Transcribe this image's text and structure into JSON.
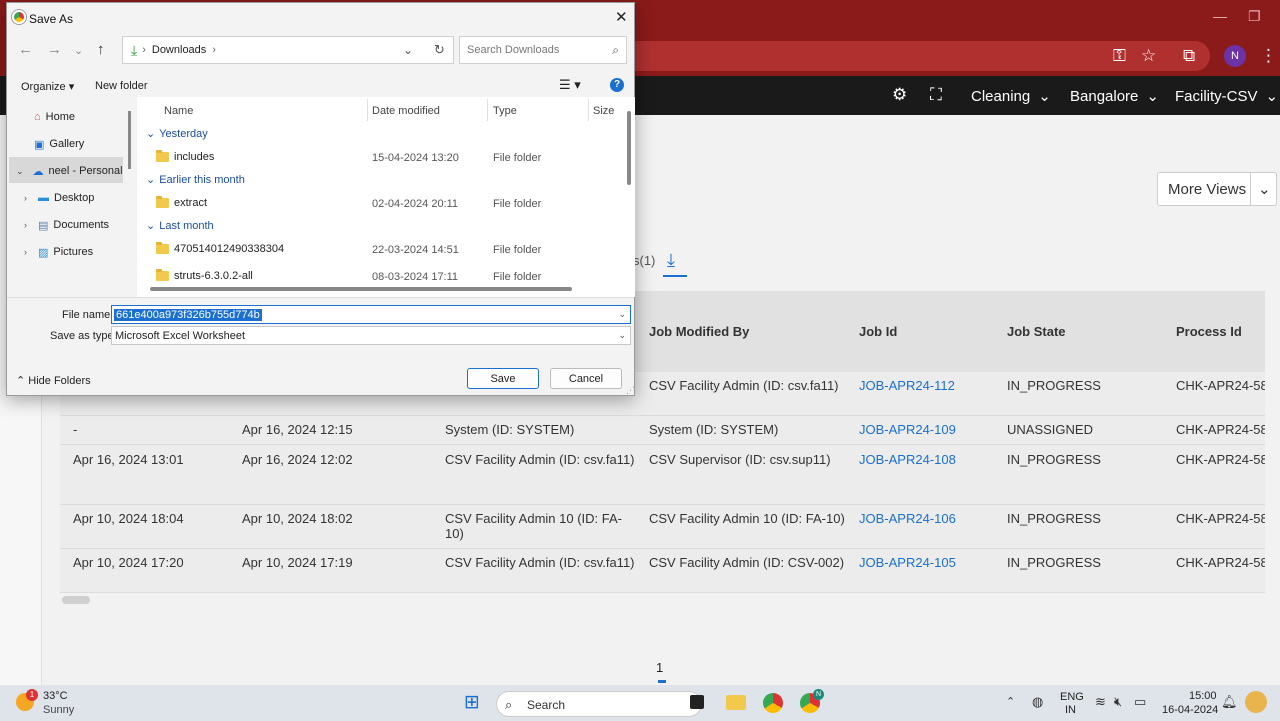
{
  "browser": {
    "avatar_initial": "N"
  },
  "app_header": {
    "items": [
      {
        "label": "Cleaning"
      },
      {
        "label": "Bangalore"
      },
      {
        "label": "Facility-CSV"
      }
    ]
  },
  "page": {
    "more_views": "More Views",
    "count_label": "s(1)",
    "page_number": "1"
  },
  "table": {
    "columns": [
      "Job Modified By",
      "Job Id",
      "Job State",
      "Process Id"
    ],
    "rows": [
      {
        "c1": "",
        "c2": "",
        "c3": "",
        "modified_by": "CSV Facility Admin (ID: csv.fa11)",
        "job_id": "JOB-APR24-112",
        "state": "IN_PROGRESS",
        "process": "CHK-APR24-58"
      },
      {
        "c1": "-",
        "c2": "Apr 16, 2024 12:15",
        "c3": "System (ID: SYSTEM)",
        "modified_by": "System (ID: SYSTEM)",
        "job_id": "JOB-APR24-109",
        "state": "UNASSIGNED",
        "process": "CHK-APR24-58"
      },
      {
        "c1": "Apr 16, 2024 13:01",
        "c2": "Apr 16, 2024 12:02",
        "c3": "CSV Facility Admin (ID: csv.fa11)",
        "modified_by": "CSV Supervisor (ID: csv.sup11)",
        "job_id": "JOB-APR24-108",
        "state": "IN_PROGRESS",
        "process": "CHK-APR24-58"
      },
      {
        "c1": "Apr 10, 2024 18:04",
        "c2": "Apr 10, 2024 18:02",
        "c3": "CSV Facility Admin 10 (ID: FA-10)",
        "modified_by": "CSV Facility Admin 10 (ID: FA-10)",
        "job_id": "JOB-APR24-106",
        "state": "IN_PROGRESS",
        "process": "CHK-APR24-58"
      },
      {
        "c1": "Apr 10, 2024 17:20",
        "c2": "Apr 10, 2024 17:19",
        "c3": "CSV Facility Admin (ID: csv.fa11)",
        "modified_by": "CSV Facility Admin (ID: CSV-002)",
        "job_id": "JOB-APR24-105",
        "state": "IN_PROGRESS",
        "process": "CHK-APR24-58"
      }
    ]
  },
  "dialog": {
    "title": "Save As",
    "path": "Downloads",
    "search_placeholder": "Search Downloads",
    "organize": "Organize",
    "new_folder": "New folder",
    "nav": [
      {
        "label": "Home"
      },
      {
        "label": "Gallery"
      },
      {
        "label": "neel - Personal"
      },
      {
        "label": "Desktop"
      },
      {
        "label": "Documents"
      },
      {
        "label": "Pictures"
      }
    ],
    "columns": {
      "name": "Name",
      "date": "Date modified",
      "type": "Type",
      "size": "Size"
    },
    "groups": [
      {
        "label": "Yesterday",
        "files": [
          {
            "name": "includes",
            "date": "15-04-2024 13:20",
            "type": "File folder"
          }
        ]
      },
      {
        "label": "Earlier this month",
        "files": [
          {
            "name": "extract",
            "date": "02-04-2024 20:11",
            "type": "File folder"
          }
        ]
      },
      {
        "label": "Last month",
        "files": [
          {
            "name": "470514012490338304",
            "date": "22-03-2024 14:51",
            "type": "File folder"
          },
          {
            "name": "struts-6.3.0.2-all",
            "date": "08-03-2024 17:11",
            "type": "File folder"
          }
        ]
      }
    ],
    "file_name_label": "File name:",
    "file_name_value": "661e400a973f326b755d774b",
    "save_type_label": "Save as type:",
    "save_type_value": "Microsoft Excel Worksheet",
    "hide_folders": "Hide Folders",
    "save": "Save",
    "cancel": "Cancel"
  },
  "taskbar": {
    "weather_badge": "1",
    "temp": "33°C",
    "condition": "Sunny",
    "search": "Search",
    "chrome_badge": "N",
    "lang_1": "ENG",
    "lang_2": "IN",
    "time": "15:00",
    "date": "16-04-2024"
  }
}
